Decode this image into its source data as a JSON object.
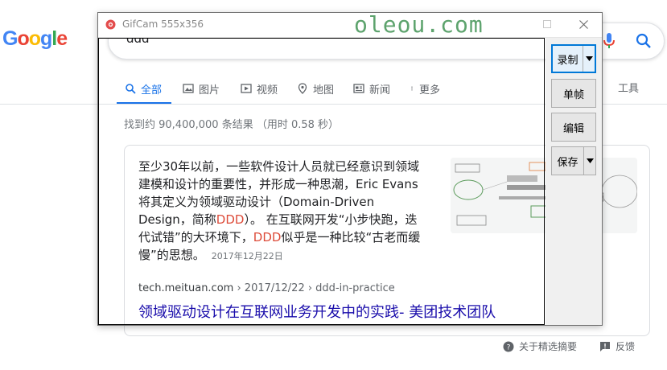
{
  "google": {
    "logo_letters": [
      "G",
      "o",
      "o",
      "g",
      "l",
      "e"
    ],
    "logo_colors": [
      "#4285f4",
      "#ea4335",
      "#fbbc05",
      "#4285f4",
      "#34a853",
      "#ea4335"
    ],
    "search_query": "ddd",
    "tabs": [
      {
        "label": "全部",
        "icon": "search-icon",
        "active": true
      },
      {
        "label": "图片",
        "icon": "image-icon",
        "active": false
      },
      {
        "label": "视频",
        "icon": "video-icon",
        "active": false
      },
      {
        "label": "地图",
        "icon": "map-pin-icon",
        "active": false
      },
      {
        "label": "新闻",
        "icon": "news-icon",
        "active": false
      },
      {
        "label": "更多",
        "icon": "more-vert-icon",
        "active": false
      }
    ],
    "tools_label": "工具",
    "result_stats": "找到约 90,400,000 条结果 （用时 0.58 秒）",
    "snippet": {
      "part1": "至少30年以前，一些软件设计人员就已经意识到领域建模和设计的重要性，并形成一种思潮，Eric Evans将其定义为领域驱动设计（Domain-Driven Design，简称",
      "hl1": "DDD",
      "part2": "）。 在互联网开发“小步快跑，迭代试错”的大环境下，",
      "hl2": "DDD",
      "part3": "似乎是一种比较“古老而缓慢”的思想。",
      "date": "2017年12月22日"
    },
    "cite": {
      "domain": "tech.meituan.com",
      "path": " › 2017/12/22 › ddd-in-practice"
    },
    "result_title": "领域驱动设计在互联网业务开发中的实践- 美团技术团队",
    "footer": {
      "about_label": "关于精选摘要",
      "feedback_label": "反馈"
    }
  },
  "gifcam": {
    "title": "GifCam 555x356",
    "watermark": "oleou.com",
    "buttons": {
      "record": "录制",
      "frame": "单帧",
      "edit": "编辑",
      "save": "保存"
    }
  },
  "colors": {
    "link": "#1a0dab",
    "accent": "#1a73e8",
    "highlight": "#dd4b39",
    "watermark": "#5da36d"
  }
}
